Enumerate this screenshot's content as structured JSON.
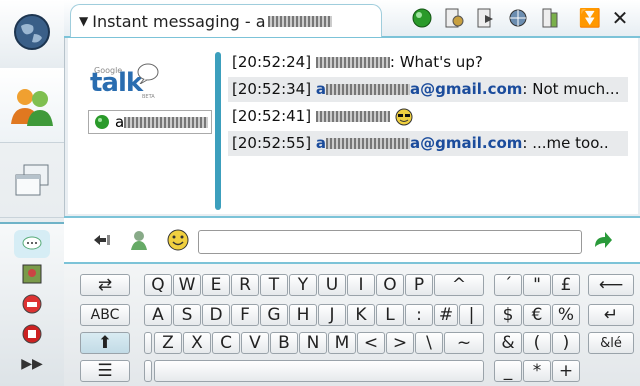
{
  "window": {
    "title": "Instant messaging - a"
  },
  "buddy": {
    "name": "a"
  },
  "messages": [
    {
      "time": "[20:52:24]",
      "name_suffix": "",
      "text": "What's up?",
      "emoji": false
    },
    {
      "time": "[20:52:34]",
      "name_prefix": "a",
      "name_suffix": "a@gmail.com",
      "text": "Not much...",
      "emoji": false
    },
    {
      "time": "[20:52:41]",
      "name_suffix": "",
      "text": "",
      "emoji": true
    },
    {
      "time": "[20:52:55]",
      "name_prefix": "a",
      "name_suffix": "a@gmail.com",
      "text": "...me too..",
      "emoji": false
    }
  ],
  "logo": {
    "small": "Google",
    "big": "talk",
    "beta": "BETA"
  },
  "keyboard": {
    "row1": [
      "Q",
      "W",
      "E",
      "R",
      "T",
      "Y",
      "U",
      "I",
      "O",
      "P",
      "^"
    ],
    "row2": [
      "A",
      "S",
      "D",
      "F",
      "G",
      "H",
      "J",
      "K",
      "L",
      ":",
      "#",
      "|"
    ],
    "row3": [
      "Z",
      "X",
      "C",
      "V",
      "B",
      "N",
      "M",
      "<",
      ">",
      "\\",
      "~"
    ],
    "side1": [
      "´",
      "\"",
      "£"
    ],
    "side2": [
      "$",
      "€",
      "%"
    ],
    "side3": [
      "&",
      "(",
      ")"
    ],
    "side4": [
      "_",
      "*",
      "+"
    ],
    "abc_label": "ABC",
    "special_label": "&lé"
  },
  "colors": {
    "accent": "#7cc3d8",
    "link": "#1b4c9c",
    "status_online": "#2a9a2a"
  }
}
